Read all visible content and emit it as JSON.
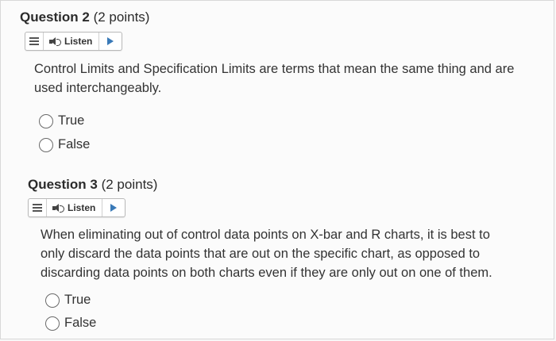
{
  "questions": [
    {
      "number_label": "Question 2",
      "points_label": "(2 points)",
      "listen_label": "Listen",
      "text": "Control Limits and Specification Limits are terms that mean the same thing and are used interchangeably.",
      "options": [
        "True",
        "False"
      ]
    },
    {
      "number_label": "Question 3",
      "points_label": "(2 points)",
      "listen_label": "Listen",
      "text": "When eliminating out of control data points on X-bar and R charts, it is best to only discard the data points that are out on the specific chart, as opposed to discarding data points on both charts even if they are only out on one of them.",
      "options": [
        "True",
        "False"
      ]
    }
  ],
  "icons": {
    "menu": "hamburger-menu-icon",
    "speaker": "speaker-icon",
    "play": "play-icon"
  },
  "colors": {
    "play_accent": "#3a7ab8",
    "background": "#fbfbfb"
  }
}
